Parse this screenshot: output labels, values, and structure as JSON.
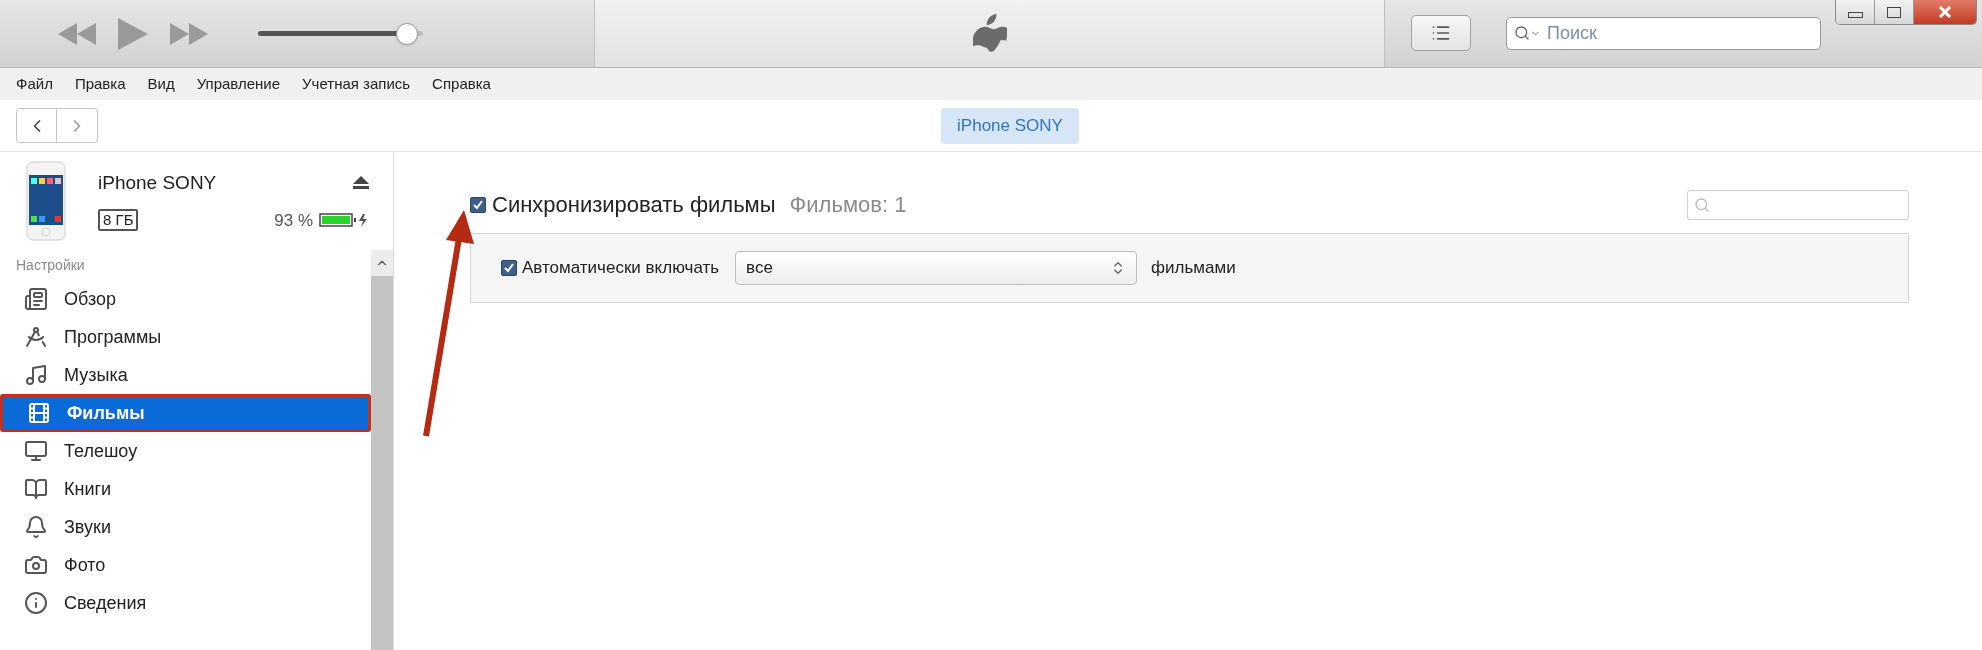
{
  "toolbar": {
    "volume": {
      "level": 0.9
    },
    "search": {
      "placeholder": "Поиск"
    }
  },
  "menu": [
    "Файл",
    "Правка",
    "Вид",
    "Управление",
    "Учетная запись",
    "Справка"
  ],
  "device_tab": "iPhone SONY",
  "device": {
    "name": "iPhone SONY",
    "capacity": "8 ГБ",
    "battery": "93 %"
  },
  "sidebar": {
    "heading": "Настройки",
    "items": [
      {
        "label": "Обзор",
        "selected": false,
        "annotated": false
      },
      {
        "label": "Программы",
        "selected": false,
        "annotated": false
      },
      {
        "label": "Музыка",
        "selected": false,
        "annotated": false
      },
      {
        "label": "Фильмы",
        "selected": true,
        "annotated": true
      },
      {
        "label": "Телешоу",
        "selected": false,
        "annotated": false
      },
      {
        "label": "Книги",
        "selected": false,
        "annotated": false
      },
      {
        "label": "Звуки",
        "selected": false,
        "annotated": false
      },
      {
        "label": "Фото",
        "selected": false,
        "annotated": false
      },
      {
        "label": "Сведения",
        "selected": false,
        "annotated": false
      }
    ]
  },
  "content": {
    "sync": {
      "label": "Синхронизировать фильмы",
      "checked": true,
      "count": "Фильмов: 1"
    },
    "auto_include": {
      "label": "Автоматически включать",
      "checked": true,
      "value": "все",
      "suffix": "фильмами"
    }
  }
}
